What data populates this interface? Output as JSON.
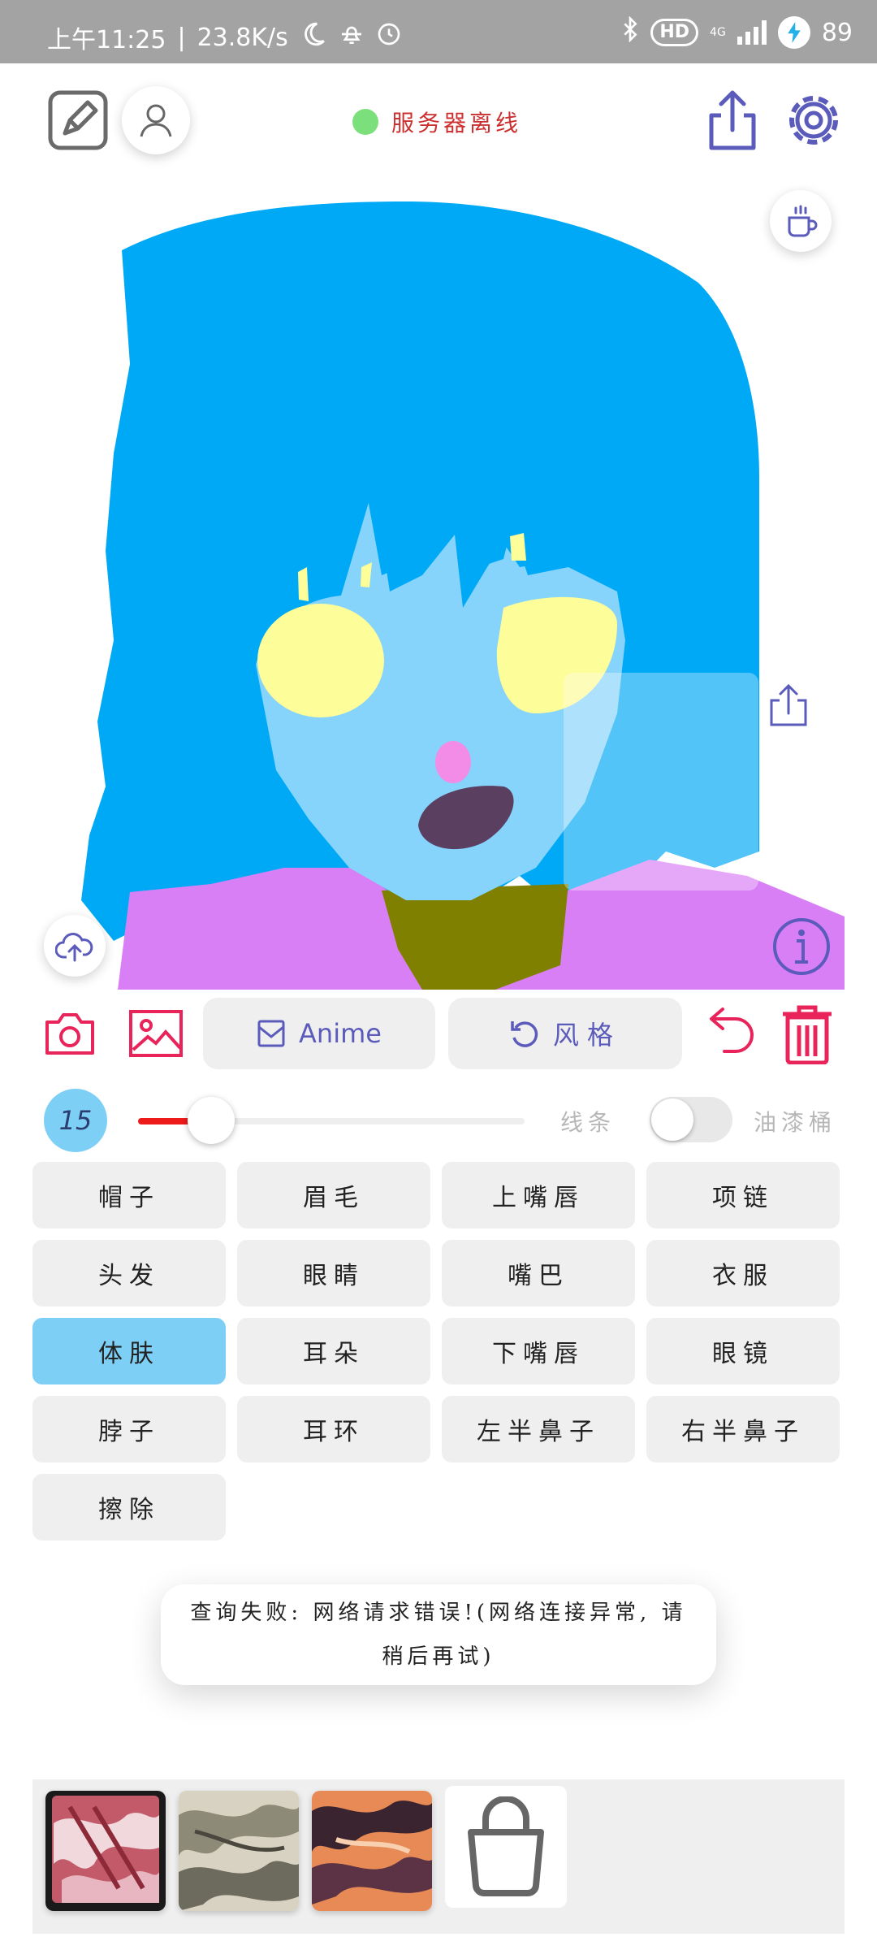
{
  "status_bar": {
    "time": "上午11:25",
    "speed": "23.8K/s",
    "hd_label": "HD",
    "network_label": "4G",
    "battery_percent": "89"
  },
  "header": {
    "server_status": "服务器离线",
    "status_color": "#7be07b"
  },
  "actions": {
    "mode_label": "Anime",
    "style_label": "风格"
  },
  "brush": {
    "size": "15",
    "slider_fraction": 0.19,
    "line_label": "线条",
    "bucket_label": "油漆桶",
    "bucket_enabled": false
  },
  "parts": [
    {
      "label": "帽子",
      "selected": false
    },
    {
      "label": "眉毛",
      "selected": false
    },
    {
      "label": "上嘴唇",
      "selected": false
    },
    {
      "label": "项链",
      "selected": false
    },
    {
      "label": "头发",
      "selected": false
    },
    {
      "label": "眼睛",
      "selected": false
    },
    {
      "label": "嘴巴",
      "selected": false
    },
    {
      "label": "衣服",
      "selected": false
    },
    {
      "label": "体肤",
      "selected": true
    },
    {
      "label": "耳朵",
      "selected": false
    },
    {
      "label": "下嘴唇",
      "selected": false
    },
    {
      "label": "眼镜",
      "selected": false
    },
    {
      "label": "脖子",
      "selected": false
    },
    {
      "label": "耳环",
      "selected": false
    },
    {
      "label": "左半鼻子",
      "selected": false
    },
    {
      "label": "右半鼻子",
      "selected": false
    },
    {
      "label": "擦除",
      "selected": false
    }
  ],
  "toast": {
    "message": "查询失败: 网络请求错误!(网络连接异常, 请稍后再试)"
  },
  "colors": {
    "accent_purple": "#5b5bbb",
    "accent_red": "#e8245a",
    "hair": "#00a9f5",
    "skin": "#86d3fb",
    "eyes": "#fdfd99",
    "mouth": "#5b3f61",
    "nose": "#f28ce6",
    "neck": "#808000",
    "clothes": "#d97ff6"
  },
  "icons": {
    "draw": "pen-square-icon",
    "user": "user-icon",
    "share": "share-icon",
    "settings": "gear-icon",
    "coffee": "coffee-cup-icon",
    "upload": "cloud-upload-icon",
    "info": "info-icon",
    "camera": "camera-icon",
    "gallery": "image-icon",
    "undo": "undo-icon",
    "delete": "trash-icon",
    "shop": "shopping-bag-icon"
  }
}
